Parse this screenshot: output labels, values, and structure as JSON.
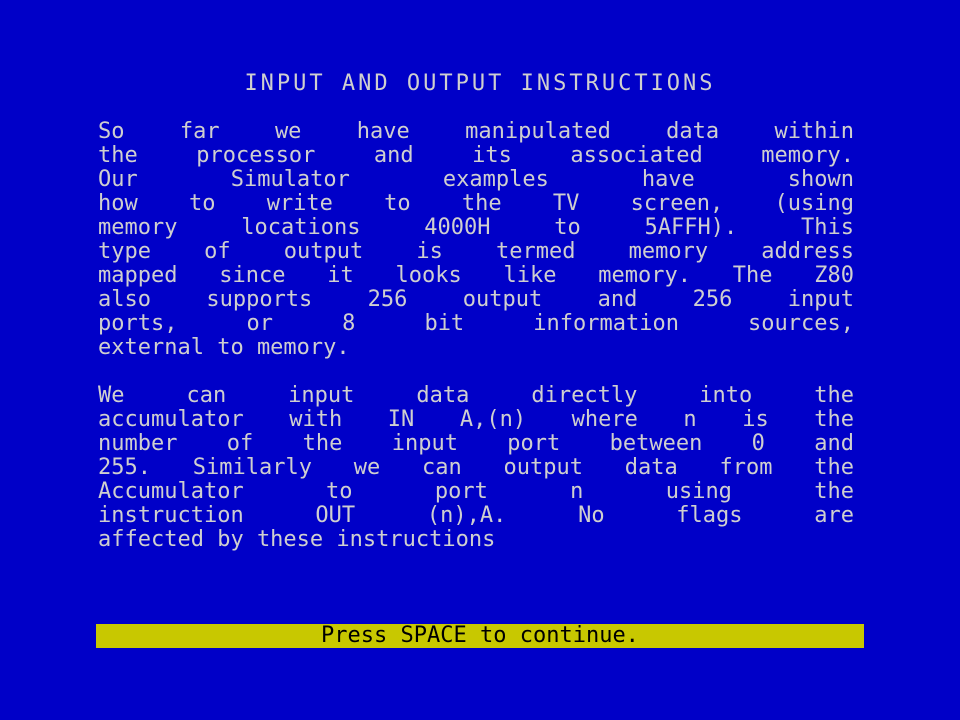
{
  "title": "INPUT AND OUTPUT INSTRUCTIONS",
  "paragraph1": [
    " So far we have manipulated data within",
    "the processor and its associated memory.",
    " Our Simulator examples have shown",
    "how to write to the TV screen, (using",
    "memory locations 4000H to 5AFFH).  This",
    "type of output is termed memory address",
    "mapped since it looks like memory. The Z80",
    "also supports 256 output and 256 input",
    "ports, or  8 bit  information sources,",
    "external to memory."
  ],
  "paragraph2": [
    " We can input data directly into the",
    "accumulator with IN A,(n) where n is the",
    "number of the input port between 0 and",
    "255. Similarly we can output data from the",
    "Accumulator to port n using the",
    "instruction OUT (n),A.  No flags are",
    "affected by these instructions"
  ],
  "prompt": "Press SPACE to continue.",
  "colors": {
    "background": "#0000c8",
    "text": "#cfcfcf",
    "prompt_bar": "#c8c800",
    "prompt_text": "#000000"
  }
}
